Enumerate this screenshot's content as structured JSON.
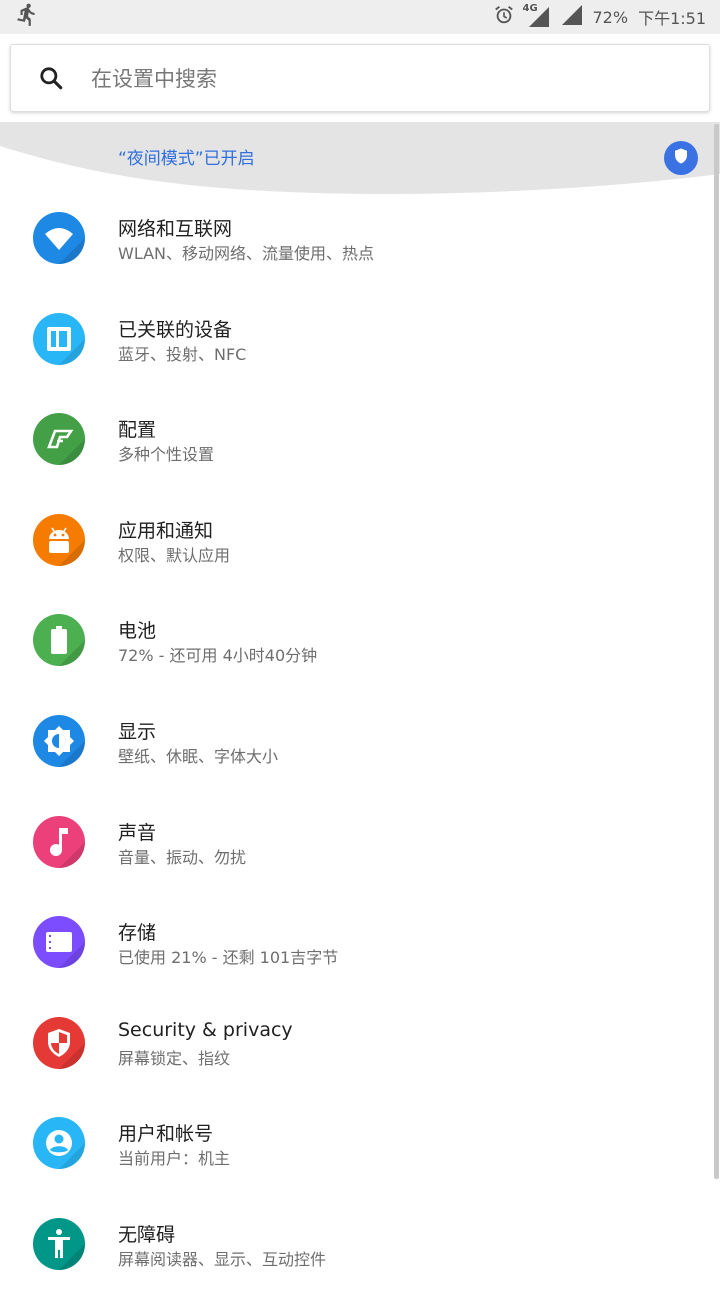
{
  "status_bar": {
    "network": "4G",
    "battery": "72%",
    "time": "下午1:51"
  },
  "search": {
    "placeholder": "在设置中搜索"
  },
  "banner": {
    "text": "“夜间模式”已开启"
  },
  "settings": [
    {
      "title": "网络和互联网",
      "subtitle": "WLAN、移动网络、流量使用、热点",
      "icon": "wifi-icon",
      "color": "#1e88e5"
    },
    {
      "title": "已关联的设备",
      "subtitle": "蓝牙、投射、NFC",
      "icon": "devices-icon",
      "color": "#29b6f6"
    },
    {
      "title": "配置",
      "subtitle": "多种个性设置",
      "icon": "theme-icon",
      "color": "#43a047"
    },
    {
      "title": "应用和通知",
      "subtitle": "权限、默认应用",
      "icon": "android-icon",
      "color": "#f57c00"
    },
    {
      "title": "电池",
      "subtitle": "72% - 还可用 4小时40分钟",
      "icon": "battery-icon",
      "color": "#4caf50"
    },
    {
      "title": "显示",
      "subtitle": "壁纸、休眠、字体大小",
      "icon": "brightness-icon",
      "color": "#1e88e5"
    },
    {
      "title": "声音",
      "subtitle": "音量、振动、勿扰",
      "icon": "music-note-icon",
      "color": "#ec407a"
    },
    {
      "title": "存储",
      "subtitle": "已使用 21% - 还剩 101吉字节",
      "icon": "storage-icon",
      "color": "#7c4dff"
    },
    {
      "title": "Security & privacy",
      "subtitle": "屏幕锁定、指纹",
      "icon": "security-shield-icon",
      "color": "#e53935"
    },
    {
      "title": "用户和帐号",
      "subtitle": "当前用户：机主",
      "icon": "account-icon",
      "color": "#29b6f6"
    },
    {
      "title": "无障碍",
      "subtitle": "屏幕阅读器、显示、互动控件",
      "icon": "accessibility-icon",
      "color": "#009688"
    }
  ]
}
